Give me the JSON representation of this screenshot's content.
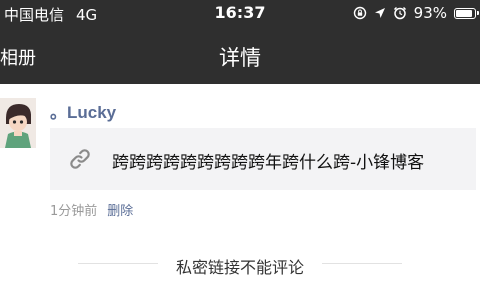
{
  "status_bar": {
    "carrier": "中国电信",
    "network": "4G",
    "time": "16:37",
    "battery": "93%",
    "battery_level": 0.93,
    "icons": [
      "rotation-lock-icon",
      "location-icon",
      "alarm-icon",
      "battery-icon"
    ]
  },
  "nav": {
    "back_label": "相册",
    "title": "详情"
  },
  "post": {
    "username": "。Lucky",
    "link_text": "跨跨跨跨跨跨跨跨跨年跨什么跨-小锋博客",
    "time_ago": "1分钟前",
    "delete_label": "删除"
  },
  "notice": "私密链接不能评论",
  "colors": {
    "bar_bg": "#2f2f2f",
    "accent": "#5a6d96",
    "card_bg": "#f3f3f5"
  }
}
